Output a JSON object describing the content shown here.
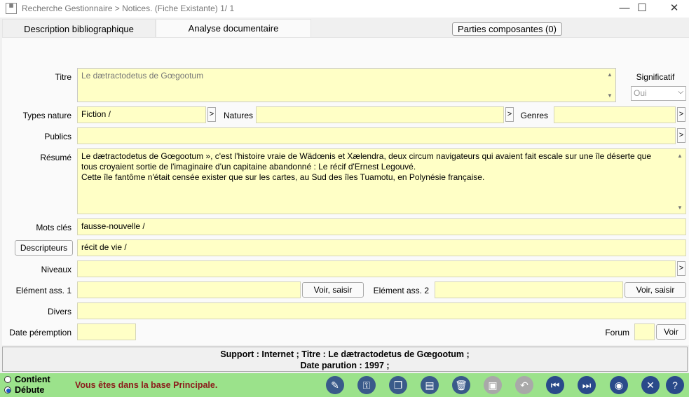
{
  "window": {
    "title": "Recherche Gestionnaire > Notices.  (Fiche Existante)     1/    1",
    "app_icon_text": "FICHE"
  },
  "tabs": {
    "description": "Description bibliographique",
    "analyse": "Analyse documentaire",
    "parties": "Parties composantes (0)"
  },
  "form": {
    "titre_label": "Titre",
    "titre_value": "Le dætractodetus de Gœgootum",
    "significatif_label": "Significatif",
    "significatif_value": "Oui",
    "types_nature_label": "Types nature",
    "types_nature_value": "Fiction /",
    "natures_label": "Natures",
    "natures_value": "",
    "genres_label": "Genres",
    "genres_value": "",
    "publics_label": "Publics",
    "publics_value": "",
    "resume_label": "Résumé",
    "resume_line1": "Le dætractodetus de Gœgootum », c'est l'histoire vraie de Wädœnis et Xælendra, deux circum navigateurs qui avaient fait escale sur une île déserte que",
    "resume_line2": "tous croyaient sortie de l'imaginaire d'un capitaine abandonné : Le récif d'Ernest Legouvé.",
    "resume_line3": "Cette île fantôme n'était censée exister que sur les cartes, au Sud des îles Tuamotu, en Polynésie française.",
    "mots_cles_label": "Mots clés",
    "mots_cles_value": "fausse-nouvelle /",
    "descripteurs_button": "Descripteurs",
    "descripteurs_value": "récit de vie /",
    "niveaux_label": "Niveaux",
    "niveaux_value": "",
    "element1_label": "Elément ass. 1",
    "element1_value": "",
    "element2_label": "Elément ass. 2",
    "element2_value": "",
    "voir_saisir": "Voir, saisir",
    "divers_label": "Divers",
    "divers_value": "",
    "date_peremption_label": "Date péremption",
    "date_peremption_value": "",
    "forum_label": "Forum",
    "forum_value": "",
    "voir_button": "Voir",
    "arrow": ">"
  },
  "status": {
    "line1": "Support  : Internet ;  Titre  : Le dætractodetus de Gœgootum ;",
    "line2": "Date parution  : 1997 ;"
  },
  "bottom": {
    "radio_contient": "Contient",
    "radio_debute": "Débute",
    "message": "Vous êtes dans la base Principale.",
    "message_color": "#8b1a1a"
  },
  "toolbar_icons": [
    "edit-icon",
    "key-icon",
    "copy-icon",
    "note-icon",
    "trash-icon",
    "save-icon",
    "undo-icon",
    "first-icon",
    "last-icon",
    "view-icon",
    "close-icon",
    "help-icon"
  ]
}
